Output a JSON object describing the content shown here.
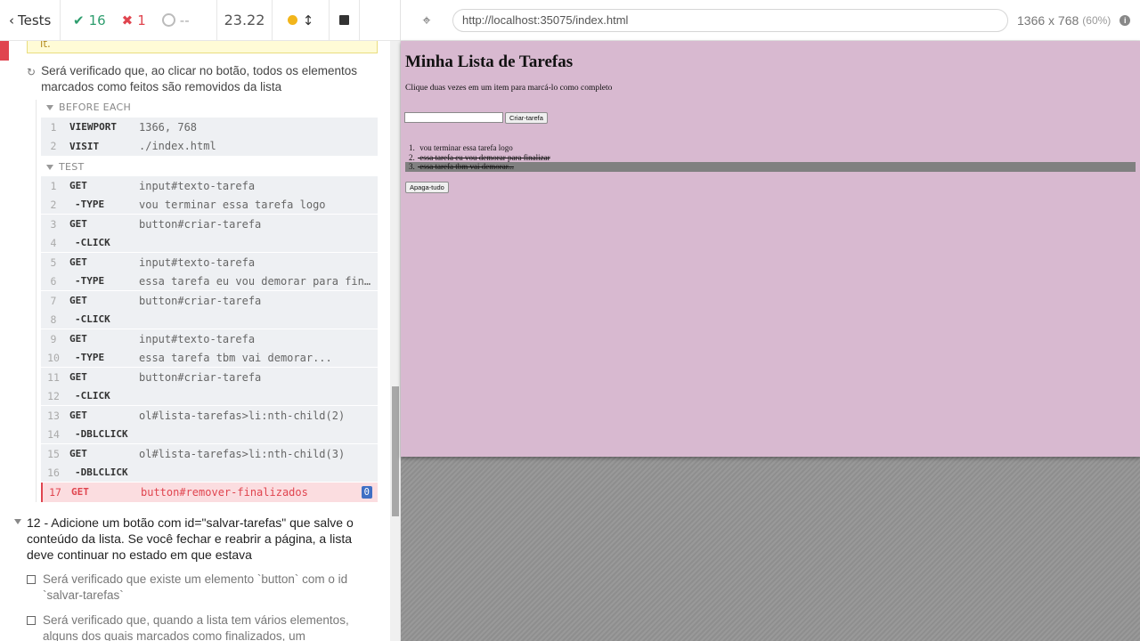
{
  "reporter": {
    "header": {
      "tests_label": "Tests",
      "passed": "16",
      "failed": "1",
      "pending": "--",
      "duration": "23.22"
    },
    "error_snippet": "it.",
    "current_test": "Será verificado que, ao clicar no botão, todos os elementos marcados como feitos são removidos da lista",
    "before_each_label": "BEFORE EACH",
    "test_label": "TEST",
    "before_each": [
      {
        "num": "1",
        "name": "VIEWPORT",
        "msg": "1366, 768",
        "child": false
      },
      {
        "num": "2",
        "name": "VISIT",
        "msg": "./index.html",
        "child": false
      }
    ],
    "commands": [
      {
        "num": "1",
        "name": "GET",
        "msg": "input#texto-tarefa",
        "child": false
      },
      {
        "num": "2",
        "name": "-TYPE",
        "msg": "vou terminar essa tarefa logo",
        "child": true
      },
      {
        "num": "3",
        "name": "GET",
        "msg": "button#criar-tarefa",
        "child": false
      },
      {
        "num": "4",
        "name": "-CLICK",
        "msg": "",
        "child": true
      },
      {
        "num": "5",
        "name": "GET",
        "msg": "input#texto-tarefa",
        "child": false
      },
      {
        "num": "6",
        "name": "-TYPE",
        "msg": "essa tarefa eu vou demorar para finalizar",
        "child": true
      },
      {
        "num": "7",
        "name": "GET",
        "msg": "button#criar-tarefa",
        "child": false
      },
      {
        "num": "8",
        "name": "-CLICK",
        "msg": "",
        "child": true
      },
      {
        "num": "9",
        "name": "GET",
        "msg": "input#texto-tarefa",
        "child": false
      },
      {
        "num": "10",
        "name": "-TYPE",
        "msg": "essa tarefa tbm vai demorar...",
        "child": true
      },
      {
        "num": "11",
        "name": "GET",
        "msg": "button#criar-tarefa",
        "child": false
      },
      {
        "num": "12",
        "name": "-CLICK",
        "msg": "",
        "child": true
      },
      {
        "num": "13",
        "name": "GET",
        "msg": "ol#lista-tarefas>li:nth-child(2)",
        "child": false
      },
      {
        "num": "14",
        "name": "-DBLCLICK",
        "msg": "",
        "child": true
      },
      {
        "num": "15",
        "name": "GET",
        "msg": "ol#lista-tarefas>li:nth-child(3)",
        "child": false
      },
      {
        "num": "16",
        "name": "-DBLCLICK",
        "msg": "",
        "child": true
      }
    ],
    "failing_command": {
      "num": "17",
      "name": "GET",
      "msg": "button#remover-finalizados",
      "badge": "0"
    },
    "next_suite": "12 - Adicione um botão com id=\"salvar-tarefas\" que salve o conteúdo da lista. Se você fechar e reabrir a página, a lista deve continuar no estado em que estava",
    "pending_tests": [
      "Será verificado que existe um elemento `button` com o id `salvar-tarefas`",
      "Será verificado que, quando a lista tem vários elementos, alguns dos quais marcados como finalizados, um"
    ]
  },
  "aut": {
    "url": "http://localhost:35075/index.html",
    "viewport": "1366 x 768",
    "scale": "(60%)",
    "app": {
      "title": "Minha Lista de Tarefas",
      "subtitle": "Clique duas vezes em um item para marcá-lo como completo",
      "create_button": "Criar-tarefa",
      "clear_button": "Apaga-tudo",
      "tasks": [
        {
          "idx": "1.",
          "text": "vou terminar essa tarefa logo",
          "done": false,
          "selected": false
        },
        {
          "idx": "2.",
          "text": "essa tarefa eu vou demorar para finalizar",
          "done": true,
          "selected": false
        },
        {
          "idx": "3.",
          "text": "essa tarefa tbm vai demorar...",
          "done": true,
          "selected": true
        }
      ]
    }
  }
}
